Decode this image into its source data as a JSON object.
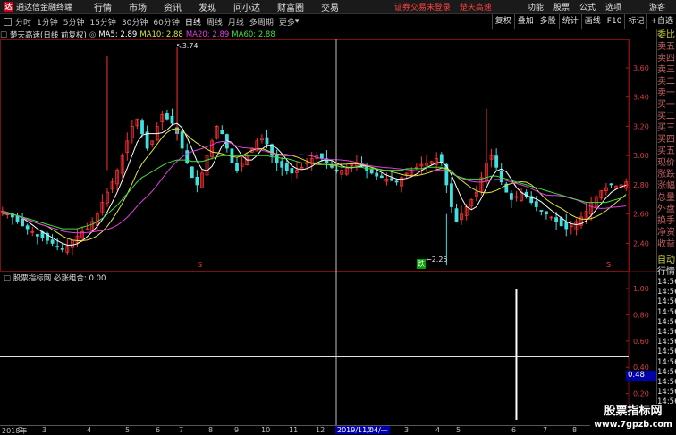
{
  "app": {
    "title": "通达信金融终端"
  },
  "menu": [
    "行情",
    "市场",
    "资讯",
    "发现",
    "问小达",
    "财富圈",
    "交易"
  ],
  "notices": {
    "login": "证券交易未登录",
    "stock": "楚天高速"
  },
  "tools": [
    "功能",
    "股票",
    "公式",
    "选项"
  ],
  "guest": "游客",
  "periods": [
    "分时",
    "1分钟",
    "5分钟",
    "15分钟",
    "30分钟",
    "60分钟",
    "日线",
    "周线",
    "月线",
    "多周期"
  ],
  "period_more": "更多",
  "active_period_index": 6,
  "right_tools": [
    "复权",
    "叠加",
    "多股",
    "统计",
    "画线",
    "F10",
    "标记",
    "+自选"
  ],
  "legend": {
    "stock_name": "楚天高速(日线 前复权)",
    "ma5": "MA5: 2.89",
    "ma10": "MA10: 2.88",
    "ma20": "MA20: 2.89",
    "ma60": "MA60: 2.88",
    "colors": {
      "ma5": "#ffffff",
      "ma10": "#e0e040",
      "ma20": "#e040e0",
      "ma60": "#40e040",
      "up": "#ff3030",
      "down": "#40e0e0"
    }
  },
  "indicator": {
    "title": "股票指标网 必涨组合: 0.00",
    "cursor_value": "0.48"
  },
  "side_labels": [
    "委比",
    "卖五",
    "卖四",
    "卖三",
    "卖二",
    "卖一",
    "买一",
    "买二",
    "买三",
    "买四",
    "买五",
    "现价",
    "涨跌",
    "涨幅",
    "总量",
    "外盘",
    "换手",
    "净资",
    "收益"
  ],
  "side_auto": "自动",
  "side_quote": "行情",
  "side_times": [
    "14:56",
    "14:56",
    "14:56",
    "14:56",
    "14:56",
    "14:56",
    "14:56",
    "14:56",
    "14:56",
    "14:56",
    "14:56",
    "14:56",
    "14:56"
  ],
  "dates": {
    "first": "2018年",
    "cursor": "2019/11/04/—",
    "months": [
      "2",
      "3",
      "4",
      "5",
      "6",
      "7",
      "8",
      "9",
      "10",
      "11",
      "12",
      "2",
      "3",
      "4",
      "5",
      "6",
      "7",
      "8"
    ]
  },
  "watermark": {
    "title": "股票指标网",
    "url": "www.7gpzb.com"
  },
  "chart_data": [
    {
      "type": "candlestick",
      "title": "楚天高速(日线 前复权)",
      "ylim": [
        2.25,
        3.74
      ],
      "yticks": [
        2.4,
        2.6,
        2.8,
        3.0,
        3.2,
        3.4,
        3.6
      ],
      "ytick_labels": [
        "2.40",
        "2.60",
        "2.80",
        "3.00",
        "3.20",
        "3.40",
        "3.60"
      ],
      "annotations": [
        {
          "label": "3.74",
          "value": 3.74
        },
        {
          "label": "2.25",
          "value": 2.25
        },
        {
          "label": "跌"
        }
      ],
      "series_close": [
        2.62,
        2.6,
        2.58,
        2.55,
        2.52,
        2.5,
        2.48,
        2.45,
        2.44,
        2.42,
        2.4,
        2.38,
        2.36,
        2.38,
        2.42,
        2.45,
        2.48,
        2.5,
        2.55,
        2.6,
        2.68,
        2.75,
        2.82,
        2.9,
        3.0,
        3.1,
        3.2,
        3.25,
        3.15,
        3.05,
        3.1,
        3.2,
        3.28,
        3.25,
        3.22,
        3.15,
        3.05,
        2.95,
        2.85,
        2.8,
        2.88,
        3.0,
        3.1,
        3.2,
        3.15,
        3.05,
        2.95,
        2.9,
        2.95,
        3.0,
        3.05,
        3.1,
        3.12,
        3.08,
        3.0,
        2.95,
        2.92,
        2.9,
        2.88,
        2.9,
        2.92,
        2.95,
        2.98,
        3.0,
        2.98,
        2.95,
        2.92,
        2.9,
        2.9,
        2.92,
        2.94,
        2.95,
        2.93,
        2.9,
        2.88,
        2.86,
        2.85,
        2.84,
        2.83,
        2.82,
        2.85,
        2.88,
        2.9,
        2.92,
        2.94,
        2.95,
        2.96,
        2.98,
        2.95,
        2.8,
        2.65,
        2.55,
        2.6,
        2.65,
        2.7,
        2.75,
        2.85,
        2.95,
        3.0,
        2.92,
        2.82,
        2.75,
        2.7,
        2.72,
        2.75,
        2.72,
        2.68,
        2.65,
        2.62,
        2.6,
        2.58,
        2.55,
        2.52,
        2.5,
        2.52,
        2.55,
        2.58,
        2.62,
        2.68,
        2.72,
        2.76,
        2.78,
        2.8,
        2.79,
        2.8,
        2.82
      ],
      "series_ma60": [
        2.6,
        2.6,
        2.6,
        2.59,
        2.58,
        2.57,
        2.56,
        2.55,
        2.54,
        2.53,
        2.52,
        2.51,
        2.5,
        2.5,
        2.5,
        2.5,
        2.51,
        2.52,
        2.53,
        2.55,
        2.57,
        2.6,
        2.63,
        2.66,
        2.7,
        2.74,
        2.78,
        2.82,
        2.85,
        2.87,
        2.89,
        2.91,
        2.93,
        2.95,
        2.96,
        2.97,
        2.97,
        2.97,
        2.96,
        2.96,
        2.96,
        2.97,
        2.98,
        2.99,
        3.0,
        3.0,
        3.0,
        3.0,
        3.0,
        3.0,
        3.0,
        3.0,
        3.0,
        3.0,
        2.99,
        2.99,
        2.98,
        2.98,
        2.97,
        2.96,
        2.95,
        2.95,
        2.95,
        2.95,
        2.94,
        2.94,
        2.93,
        2.93,
        2.92,
        2.92,
        2.92,
        2.92,
        2.92,
        2.91,
        2.91,
        2.91,
        2.9,
        2.9,
        2.9,
        2.9,
        2.9,
        2.91,
        2.91,
        2.91,
        2.91,
        2.92,
        2.92,
        2.92,
        2.92,
        2.9,
        2.88,
        2.86,
        2.85,
        2.84,
        2.84,
        2.84,
        2.84,
        2.85,
        2.86,
        2.86,
        2.85,
        2.84,
        2.83,
        2.82,
        2.81,
        2.8,
        2.79,
        2.78,
        2.77,
        2.76,
        2.75,
        2.74,
        2.73,
        2.72,
        2.71,
        2.7,
        2.69,
        2.68,
        2.68,
        2.68,
        2.68,
        2.68,
        2.69,
        2.7,
        2.71,
        2.72
      ]
    },
    {
      "type": "bar",
      "title": "必涨组合",
      "ylim": [
        0,
        1.0
      ],
      "yticks": [
        0.2,
        0.4,
        0.6,
        0.8,
        1.0
      ],
      "ytick_labels": [
        "0.20",
        "0.40",
        "0.60",
        "0.80",
        "1.00"
      ],
      "spike_index": 103,
      "spike_value": 1.0
    }
  ]
}
